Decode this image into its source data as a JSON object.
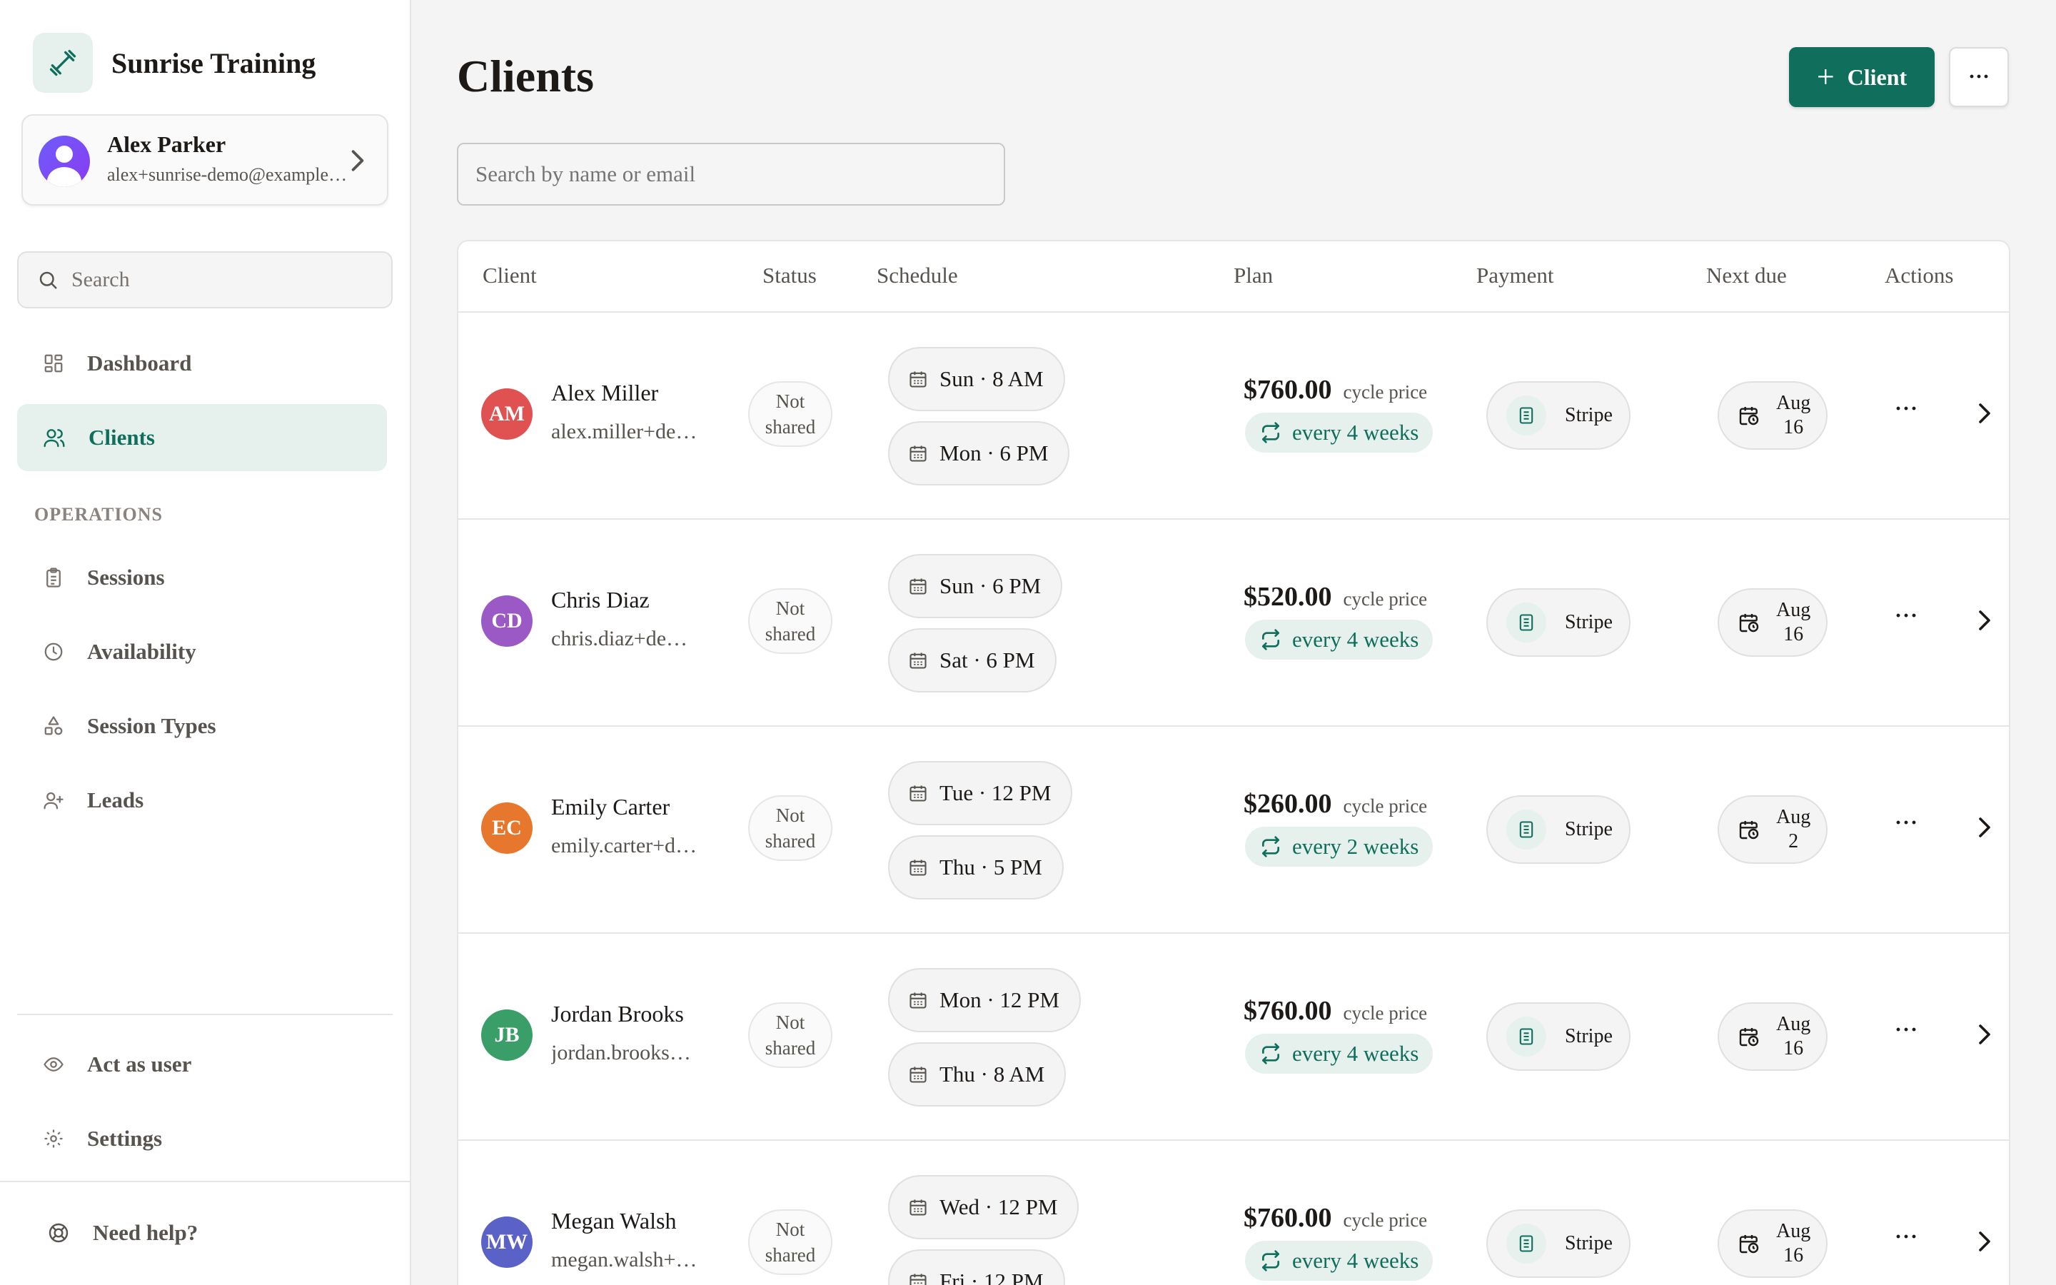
{
  "sidebar": {
    "brand": "Sunrise Training",
    "user": {
      "name": "Alex Parker",
      "email": "alex+sunrise-demo@example.com"
    },
    "search_placeholder": "Search",
    "nav": [
      {
        "label": "Dashboard",
        "icon": "grid-icon"
      },
      {
        "label": "Clients",
        "icon": "users-icon",
        "active": true
      }
    ],
    "section_label": "OPERATIONS",
    "operations": [
      {
        "label": "Sessions",
        "icon": "clipboard-icon"
      },
      {
        "label": "Availability",
        "icon": "clock-icon"
      },
      {
        "label": "Session Types",
        "icon": "shapes-icon"
      },
      {
        "label": "Leads",
        "icon": "user-plus-icon"
      }
    ],
    "bottom": [
      {
        "label": "Act as user",
        "icon": "eye-icon"
      },
      {
        "label": "Settings",
        "icon": "gear-icon"
      }
    ],
    "help": "Need help?"
  },
  "header": {
    "title": "Clients",
    "add_button": "Client",
    "more_button": "···"
  },
  "search": {
    "placeholder": "Search by name or email"
  },
  "table": {
    "columns": [
      "Client",
      "Status",
      "Schedule",
      "Plan",
      "Payment",
      "Next due",
      "Actions"
    ],
    "rows": [
      {
        "initials": "AM",
        "avatar_color": "#e05252",
        "name": "Alex Miller",
        "email": "alex.miller+demo@example.com",
        "status_line1": "Not",
        "status_line2": "shared",
        "schedule": [
          "Sun · 8 AM",
          "Mon · 6 PM"
        ],
        "price": "$760.00",
        "price_label": "cycle price",
        "cycle": "every 4 weeks",
        "payment": "Stripe",
        "due_month": "Aug",
        "due_day": "16",
        "actions": "···"
      },
      {
        "initials": "CD",
        "avatar_color": "#9b59c6",
        "name": "Chris Diaz",
        "email": "chris.diaz+demo@example.com",
        "status_line1": "Not",
        "status_line2": "shared",
        "schedule": [
          "Sun · 6 PM",
          "Sat · 6 PM"
        ],
        "price": "$520.00",
        "price_label": "cycle price",
        "cycle": "every 4 weeks",
        "payment": "Stripe",
        "due_month": "Aug",
        "due_day": "16",
        "actions": "···"
      },
      {
        "initials": "EC",
        "avatar_color": "#e8772e",
        "name": "Emily Carter",
        "email": "emily.carter+demo@example.com",
        "status_line1": "Not",
        "status_line2": "shared",
        "schedule": [
          "Tue · 12 PM",
          "Thu · 5 PM"
        ],
        "price": "$260.00",
        "price_label": "cycle price",
        "cycle": "every 2 weeks",
        "payment": "Stripe",
        "due_month": "Aug",
        "due_day": "2",
        "actions": "···"
      },
      {
        "initials": "JB",
        "avatar_color": "#3a9e68",
        "name": "Jordan Brooks",
        "email": "jordan.brooks+demo@example.com",
        "status_line1": "Not",
        "status_line2": "shared",
        "schedule": [
          "Mon · 12 PM",
          "Thu · 8 AM"
        ],
        "price": "$760.00",
        "price_label": "cycle price",
        "cycle": "every 4 weeks",
        "payment": "Stripe",
        "due_month": "Aug",
        "due_day": "16",
        "actions": "···"
      },
      {
        "initials": "MW",
        "avatar_color": "#5a62c8",
        "name": "Megan Walsh",
        "email": "megan.walsh+demo@example.com",
        "status_line1": "Not",
        "status_line2": "shared",
        "schedule": [
          "Wed · 12 PM",
          "Fri · 12 PM"
        ],
        "price": "$760.00",
        "price_label": "cycle price",
        "cycle": "every 4 weeks",
        "payment": "Stripe",
        "due_month": "Aug",
        "due_day": "16",
        "actions": "···"
      }
    ]
  },
  "colors": {
    "accent": "#0f6e5c",
    "accent_soft": "#e6f1ee"
  }
}
